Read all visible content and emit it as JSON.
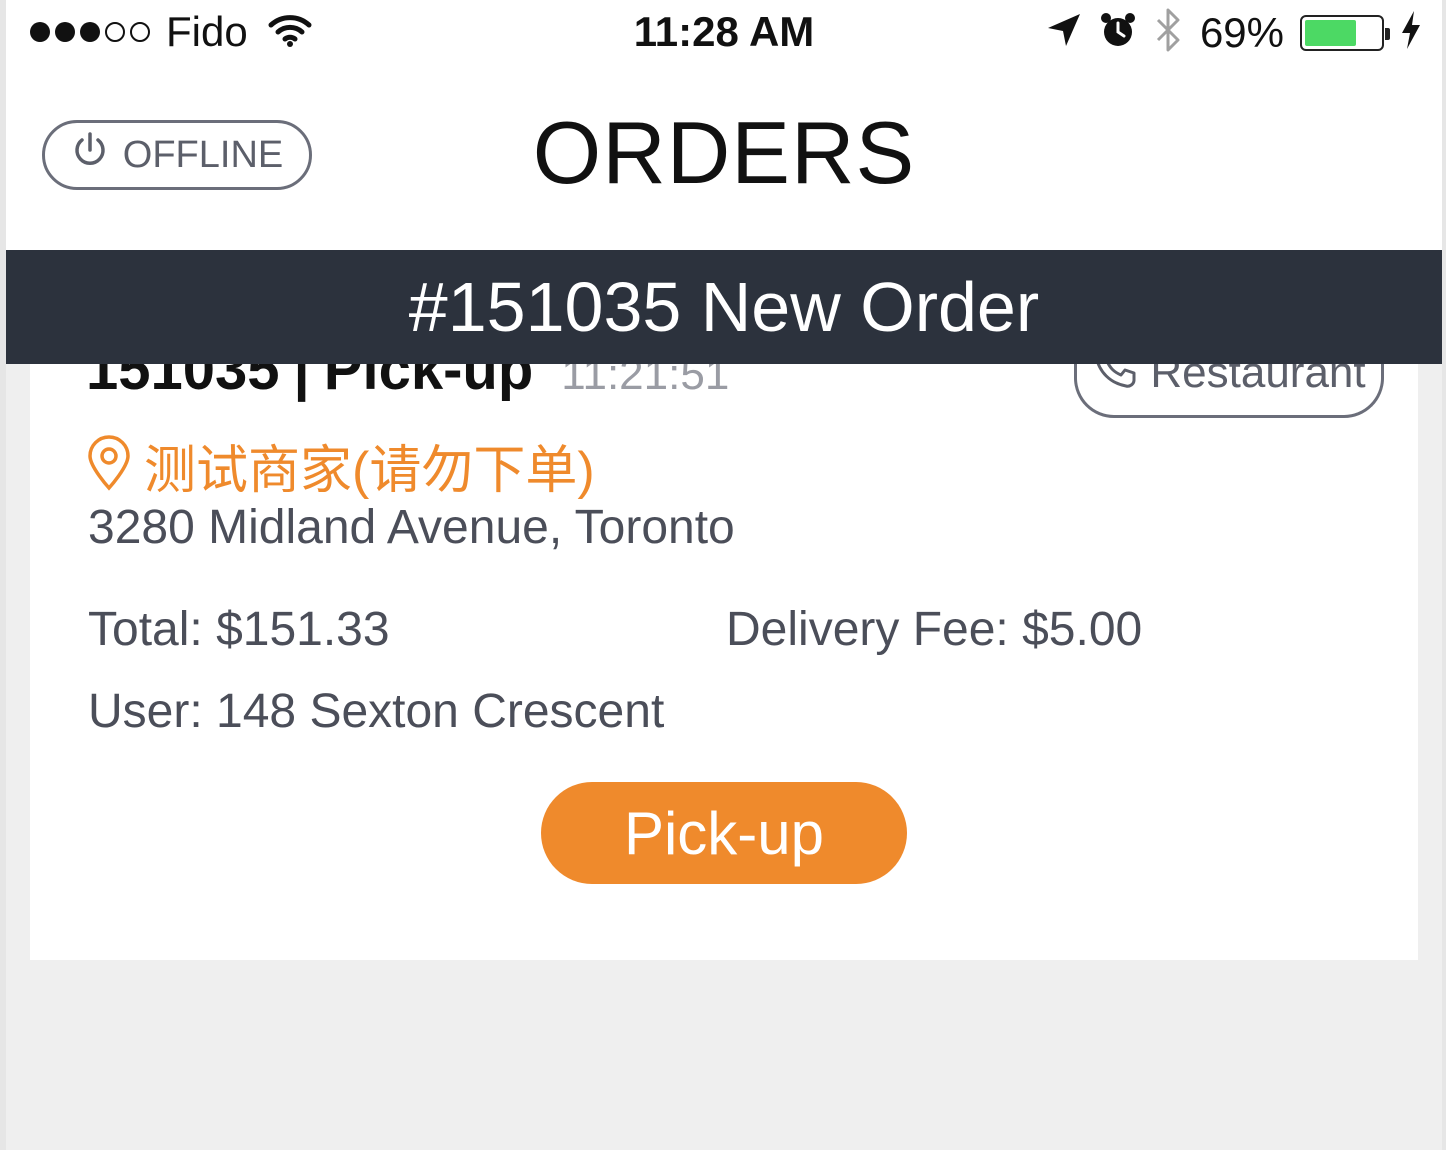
{
  "status_bar": {
    "carrier": "Fido",
    "time": "11:28 AM",
    "battery_percent": "69%",
    "battery_level": 0.69,
    "signal_bars_filled": 3,
    "signal_bars_total": 5,
    "icons": [
      "signal-icon",
      "wifi-icon",
      "location-arrow-icon",
      "alarm-icon",
      "bluetooth-icon",
      "battery-icon",
      "charging-bolt-icon"
    ]
  },
  "nav": {
    "offline_label": "OFFLINE",
    "title": "ORDERS"
  },
  "banner": {
    "text": "#151035 New Order"
  },
  "order": {
    "id": "151035",
    "separator": "|",
    "type": "Pick-up",
    "time": "11:21:51",
    "restaurant_button": "Restaurant",
    "merchant_name": "测试商家(请勿下单)",
    "address": "3280 Midland Avenue, Toronto",
    "total": "Total: $151.33",
    "delivery_fee": "Delivery Fee: $5.00",
    "user": "User: 148 Sexton Crescent",
    "action_button": "Pick-up"
  },
  "colors": {
    "accent_orange": "#ef8a2c",
    "banner_bg": "#2c323d",
    "text_gray": "#4b4e59",
    "battery_green": "#4cd964",
    "background": "#efefef"
  }
}
